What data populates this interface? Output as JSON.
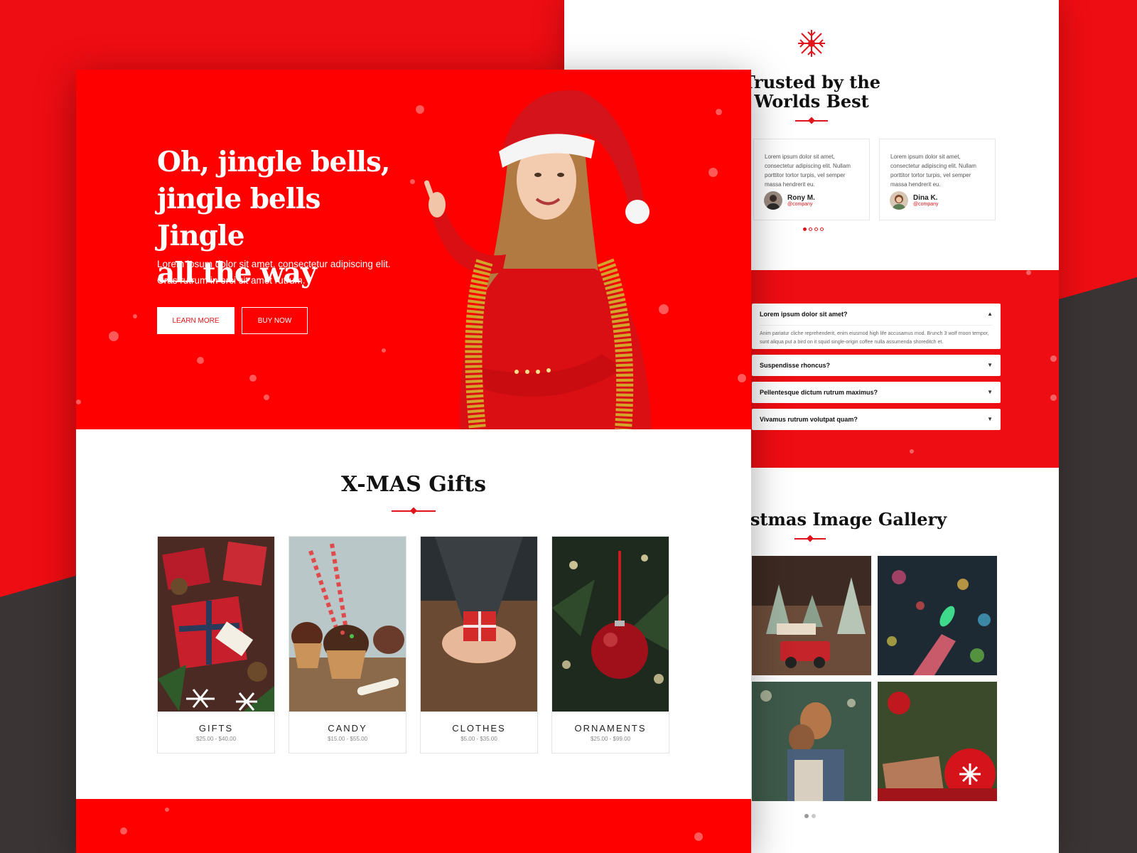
{
  "hero": {
    "title_line1": "Oh, jingle bells,",
    "title_line2": "jingle bells Jingle",
    "title_line3": "all the way",
    "subtitle_line1": "Lorem ipsum dolor sit amet, consectetur adipiscing elit.",
    "subtitle_line2": "Cras rutrum in orci sit amet rutrum.",
    "learn_more": "LEARN MORE",
    "buy_now": "BUY NOW"
  },
  "gifts": {
    "title": "X-MAS Gifts",
    "items": [
      {
        "name": "GIFTS",
        "price": "$25.00 - $40.00"
      },
      {
        "name": "CANDY",
        "price": "$15.00 - $55.00"
      },
      {
        "name": "CLOTHES",
        "price": "$5.00 - $35.00"
      },
      {
        "name": "ORNAMENTS",
        "price": "$25.00 - $99.00"
      }
    ]
  },
  "testimonials": {
    "title_line1": "Trusted by the",
    "title_line2": "Worlds Best",
    "items": [
      {
        "text": "Lorem ipsum dolor sit amet, consectetur adipiscing elit. Nullam porttitor tortor turpis, vel semper massa hendrerit eu.",
        "name": "Rony M.",
        "handle": "@company"
      },
      {
        "text": "Lorem ipsum dolor sit amet, consectetur adipiscing elit. Nullam porttitor tortor turpis, vel semper massa hendrerit eu.",
        "name": "Dina K.",
        "handle": "@company"
      }
    ]
  },
  "faq": {
    "items": [
      {
        "question": "Lorem ipsum dolor sit amet?",
        "answer": "Anim pariatur cliche reprehenderit, enim eiusmod high life accusamus mod. Brunch 3 wolf moon tempor, sunt aliqua put a bird on it squid single-origin coffee nulla assumenda shoreditch et."
      },
      {
        "question": "Suspendisse rhoncus?"
      },
      {
        "question": "Pellentesque dictum rutrum maximus?"
      },
      {
        "question": "Vivamus rutrum volutpat quam?"
      }
    ]
  },
  "gallery": {
    "title": "stmas Image Gallery"
  },
  "colors": {
    "brand_red": "#ff0000",
    "accent": "#e0141a",
    "dark": "#3a3435"
  }
}
